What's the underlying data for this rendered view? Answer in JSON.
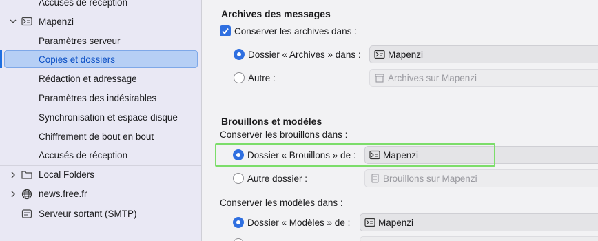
{
  "sidebar": {
    "items": [
      {
        "label": "Accusés de réception"
      },
      {
        "label": "Mapenzi"
      },
      {
        "label": "Paramètres serveur"
      },
      {
        "label": "Copies et dossiers"
      },
      {
        "label": "Rédaction et adressage"
      },
      {
        "label": "Paramètres des indésirables"
      },
      {
        "label": "Synchronisation et espace disque"
      },
      {
        "label": "Chiffrement de bout en bout"
      },
      {
        "label": "Accusés de réception"
      },
      {
        "label": "Local Folders"
      },
      {
        "label": "news.free.fr"
      },
      {
        "label": "Serveur sortant (SMTP)"
      }
    ]
  },
  "archives": {
    "title": "Archives des messages",
    "keep_label": "Conserver les archives dans :",
    "folder_option": "Dossier « Archives » dans :",
    "folder_value": "Mapenzi",
    "other_option": "Autre :",
    "other_value": "Archives sur Mapenzi"
  },
  "drafts": {
    "title": "Brouillons et modèles",
    "keep_label": "Conserver les brouillons dans :",
    "folder_option": "Dossier « Brouillons » de :",
    "folder_value": "Mapenzi",
    "other_option": "Autre dossier :",
    "other_value": "Brouillons sur Mapenzi",
    "templates_label": "Conserver les modèles dans :",
    "templates_option": "Dossier « Modèles » de :",
    "templates_value": "Mapenzi"
  },
  "colors": {
    "accent": "#2f6fe0",
    "highlight": "#7cdd6a",
    "sidebar_bg": "#e9e8f4"
  }
}
